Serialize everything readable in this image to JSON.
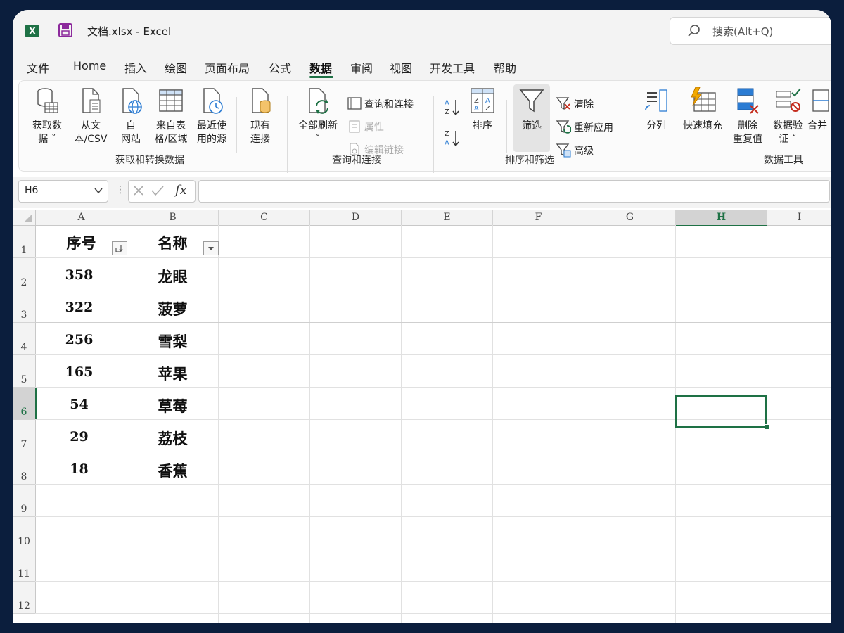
{
  "titlebar": {
    "file_name": "文档.xlsx",
    "separator": " - ",
    "app_name": "Excel",
    "search_placeholder": "搜索(Alt+Q)"
  },
  "menu": [
    {
      "label": "文件"
    },
    {
      "label": "Home"
    },
    {
      "label": "插入"
    },
    {
      "label": "绘图"
    },
    {
      "label": "页面布局"
    },
    {
      "label": "公式"
    },
    {
      "label": "数据",
      "active": true
    },
    {
      "label": "审阅"
    },
    {
      "label": "视图"
    },
    {
      "label": "开发工具"
    },
    {
      "label": "帮助"
    }
  ],
  "ribbon": {
    "get_transform": {
      "group_label": "获取和转换数据",
      "get_data_1": "获取数",
      "get_data_2": "据 ˅",
      "from_text_1": "从文",
      "from_text_2": "本/CSV",
      "from_web_1": "自",
      "from_web_2": "网站",
      "from_table_1": "来自表",
      "from_table_2": "格/区域",
      "recent_1": "最近使",
      "recent_2": "用的源",
      "existing_1": "现有",
      "existing_2": "连接"
    },
    "queries": {
      "group_label": "查询和连接",
      "refresh_all": "全部刷新",
      "refresh_chevron": "˅",
      "queries_connections": "查询和连接",
      "properties": "属性",
      "edit_links": "编辑链接"
    },
    "sort_filter": {
      "group_label": "排序和筛选",
      "sort": "排序",
      "filter": "筛选",
      "clear": "清除",
      "reapply": "重新应用",
      "advanced": "高级"
    },
    "data_tools": {
      "group_label": "数据工具",
      "text_to_columns": "分列",
      "flash_fill": "快速填充",
      "remove_dup_1": "删除",
      "remove_dup_2": "重复值",
      "validation_1": "数据验",
      "validation_2": "证 ˅",
      "consolidate": "合并"
    }
  },
  "formula_bar": {
    "name_box": "H6",
    "dots": "⋮",
    "fx": "fx",
    "formula": ""
  },
  "sheet": {
    "columns": [
      "A",
      "B",
      "C",
      "D",
      "E",
      "F",
      "G",
      "H",
      "I"
    ],
    "rows": [
      "1",
      "2",
      "3",
      "4",
      "5",
      "6",
      "7",
      "8",
      "9",
      "10",
      "11",
      "12"
    ],
    "header": {
      "a": "序号",
      "b": "名称"
    },
    "data": [
      {
        "a": "358",
        "b": "龙眼"
      },
      {
        "a": "322",
        "b": "菠萝"
      },
      {
        "a": "256",
        "b": "雪梨"
      },
      {
        "a": "165",
        "b": "苹果"
      },
      {
        "a": "54",
        "b": "草莓"
      },
      {
        "a": "29",
        "b": "荔枝"
      },
      {
        "a": "18",
        "b": "香蕉"
      }
    ],
    "selected_cell": "H6",
    "accent_color": "#1e7145"
  }
}
